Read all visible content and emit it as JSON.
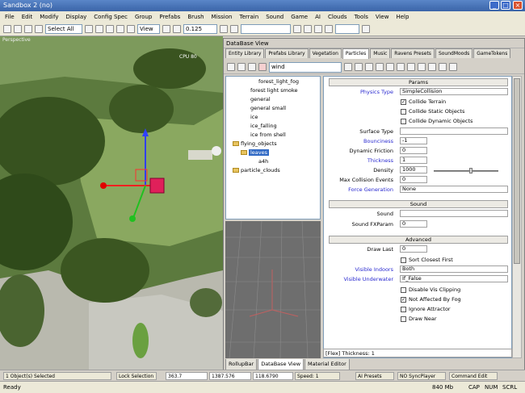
{
  "window": {
    "title": "Sandbox 2 (no)"
  },
  "menu": [
    "File",
    "Edit",
    "Modify",
    "Display",
    "Config Spec",
    "Group",
    "Prefabs",
    "Brush",
    "Mission",
    "Terrain",
    "Sound",
    "Game",
    "AI",
    "Clouds",
    "Tools",
    "View",
    "Help"
  ],
  "toolbar": {
    "select_mode": "Select All",
    "view": "View",
    "snap": "0.125"
  },
  "viewport": {
    "label": "Perspective",
    "overlay": "CPU 80"
  },
  "db": {
    "title": "DataBase View",
    "tabs": [
      "Entity Library",
      "Prefabs Library",
      "Vegetation",
      "Particles",
      "Music",
      "Ravens Presets",
      "SoundMoods",
      "GameTokens"
    ],
    "filter": "wind",
    "tree": [
      "forest_light_fog",
      "forest light smoke",
      "general",
      "general small",
      "ice",
      "ice_falling",
      "ice from shell",
      "flying_objects",
      "leaves",
      "a4h",
      "particle_clouds"
    ],
    "sections": {
      "params": "Params",
      "sound": "Sound",
      "advanced": "Advanced"
    },
    "props": {
      "physics_type": {
        "label": "Physics Type",
        "value": "SimpleCollision"
      },
      "collide_terrain": "Collide Terrain",
      "collide_static": "Collide Static Objects",
      "collide_dynamic": "Collide Dynamic Objects",
      "surface_type": {
        "label": "Surface Type",
        "value": ""
      },
      "bounciness": {
        "label": "Bounciness",
        "value": "-1"
      },
      "dynamic_friction": {
        "label": "Dynamic Friction",
        "value": "0"
      },
      "thickness": {
        "label": "Thickness",
        "value": "1"
      },
      "density": {
        "label": "Density",
        "value": "1000"
      },
      "max_collision": {
        "label": "Max Collision Events",
        "value": "0"
      },
      "force_generation": {
        "label": "Force Generation",
        "value": "None"
      },
      "sound": {
        "label": "Sound",
        "value": ""
      },
      "sound_param": {
        "label": "Sound FXParam",
        "value": "0"
      },
      "draw_last": {
        "label": "Draw Last",
        "value": "0"
      },
      "sort_closest": "Sort Closest First",
      "visible_indoors": {
        "label": "Visible Indoors",
        "value": "Both"
      },
      "visible_underwater": {
        "label": "Visible Underwater",
        "value": "If_False"
      },
      "disable_clipping": "Disable Vis Clipping",
      "not_affected_fog": "Not Affected By Fog",
      "ignore_attractor": "Ignore Attractor",
      "draw_near": "Draw Near"
    },
    "status": "[Flex] Thickness: 1",
    "bottom_tabs": [
      "RollupBar",
      "DataBase View",
      "Material Editor"
    ]
  },
  "bottom": {
    "selection": "1 Object(s) Selected",
    "lock": "Lock Selection",
    "x": "363.7",
    "y": "1387.576",
    "z": "118.6790",
    "speed": "Speed: 1",
    "ai_msg": "AI Presets",
    "sync": "NO SyncPlayer",
    "cmd": "Command Edit"
  },
  "statusbar": {
    "ready": "Ready",
    "mem": "840 Mb",
    "cap": "CAP",
    "num": "NUM",
    "scrl": "SCRL"
  }
}
